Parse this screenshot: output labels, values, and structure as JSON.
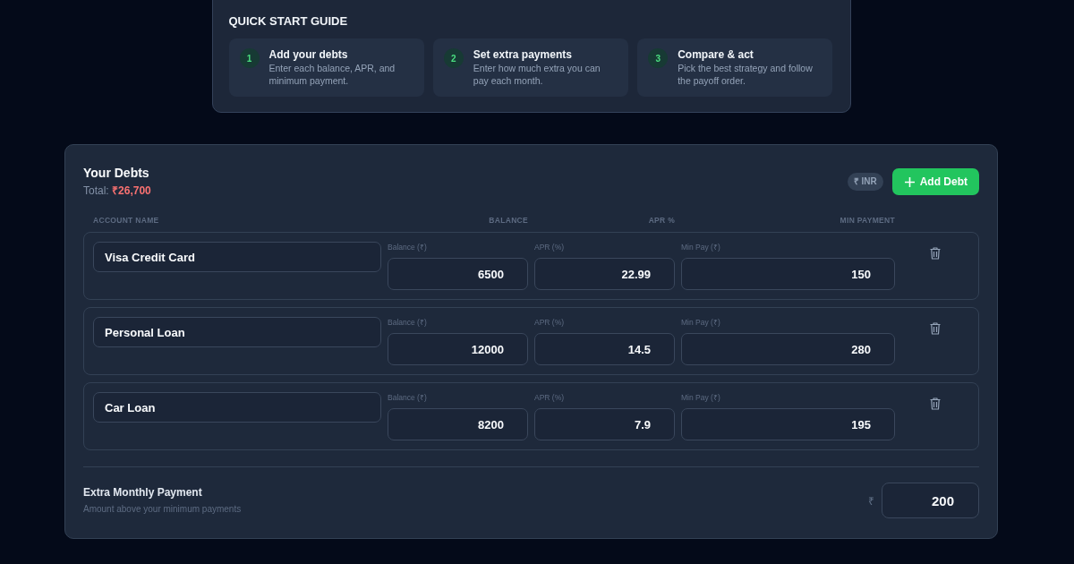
{
  "quick_start": {
    "title": "QUICK START GUIDE",
    "steps": [
      {
        "number": "1",
        "title": "Add your debts",
        "description": "Enter each balance, APR, and minimum payment."
      },
      {
        "number": "2",
        "title": "Set extra payments",
        "description": "Enter how much extra you can pay each month."
      },
      {
        "number": "3",
        "title": "Compare & act",
        "description": "Pick the best strategy and follow the payoff order."
      }
    ]
  },
  "debts": {
    "title": "Your Debts",
    "total_label": "Total:",
    "total_value": "₹26,700",
    "currency_badge": "₹ INR",
    "add_button": "Add Debt",
    "columns": [
      "ACCOUNT NAME",
      "BALANCE",
      "APR %",
      "MIN PAYMENT"
    ],
    "rows": [
      {
        "name": "Visa Credit Card",
        "balance_label": "Balance (₹)",
        "balance": "6500",
        "apr_label": "APR (%)",
        "apr": "22.99",
        "min_pay_label": "Min Pay (₹)",
        "min_pay": "150"
      },
      {
        "name": "Personal Loan",
        "balance_label": "Balance (₹)",
        "balance": "12000",
        "apr_label": "APR (%)",
        "apr": "14.5",
        "min_pay_label": "Min Pay (₹)",
        "min_pay": "280"
      },
      {
        "name": "Car Loan",
        "balance_label": "Balance (₹)",
        "balance": "8200",
        "apr_label": "APR (%)",
        "apr": "7.9",
        "min_pay_label": "Min Pay (₹)",
        "min_pay": "195"
      }
    ]
  },
  "extra_payment": {
    "title": "Extra Monthly Payment",
    "subtitle": "Amount above your minimum payments",
    "currency": "₹",
    "value": "200"
  }
}
